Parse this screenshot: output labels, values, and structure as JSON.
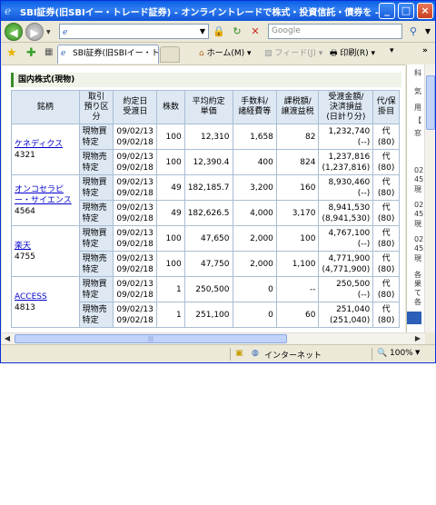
{
  "window": {
    "title": "SBI証券(旧SBIイー・トレード証券) - オンライントレードで株式・投資信託・債券を - Win...",
    "minimize_label": "_",
    "maximize_label": "□",
    "close_label": "×"
  },
  "addressbar": {
    "url": "",
    "search_placeholder": "Google"
  },
  "tabs": [
    {
      "label": "SBI証券(旧SBIイー・トレー..."
    }
  ],
  "commandbar": {
    "home_label": "ホーム(M)",
    "feed_label": "フィード(J)",
    "print_label": "印刷(R)"
  },
  "section": {
    "title": "国内株式(現物)"
  },
  "table": {
    "headers": {
      "meigara": "銘柄",
      "torihiki": "取引\n預り区分",
      "date": "約定日\n受渡日",
      "kabusu": "株数",
      "price": "平均約定\n単価",
      "fee": "手数料/\n諸経費等",
      "tax": "課税額/\n譲渡益税",
      "amount": "受渡金額/\n決済損益\n(日計り分)",
      "dai": "代/保\n掛目"
    },
    "stocks": [
      {
        "name": "ケネディクス",
        "code": "4321",
        "rows": [
          {
            "torihiki": "現物買",
            "kubun": "特定",
            "yakujo": "09/02/13",
            "ukewatashi": "09/02/18",
            "kabusu": "100",
            "price": "12,310",
            "fee": "1,658",
            "tax": "82",
            "amount": "1,232,740",
            "pl": "(--)",
            "dai": "代",
            "kakeme": "(80)"
          },
          {
            "torihiki": "現物売",
            "kubun": "特定",
            "yakujo": "09/02/13",
            "ukewatashi": "09/02/18",
            "kabusu": "100",
            "price": "12,390.4",
            "fee": "400",
            "tax": "824",
            "amount": "1,237,816",
            "pl": "(1,237,816)",
            "dai": "代",
            "kakeme": "(80)"
          }
        ]
      },
      {
        "name": "オンコセラピー・サイエンス",
        "code": "4564",
        "rows": [
          {
            "torihiki": "現物買",
            "kubun": "特定",
            "yakujo": "09/02/13",
            "ukewatashi": "09/02/18",
            "kabusu": "49",
            "price": "182,185.7",
            "fee": "3,200",
            "tax": "160",
            "amount": "8,930,460",
            "pl": "(--)",
            "dai": "代",
            "kakeme": "(80)"
          },
          {
            "torihiki": "現物売",
            "kubun": "特定",
            "yakujo": "09/02/13",
            "ukewatashi": "09/02/18",
            "kabusu": "49",
            "price": "182,626.5",
            "fee": "4,000",
            "tax": "3,170",
            "amount": "8,941,530",
            "pl": "(8,941,530)",
            "dai": "代",
            "kakeme": "(80)"
          }
        ]
      },
      {
        "name": "楽天",
        "code": "4755",
        "rows": [
          {
            "torihiki": "現物買",
            "kubun": "特定",
            "yakujo": "09/02/13",
            "ukewatashi": "09/02/18",
            "kabusu": "100",
            "price": "47,650",
            "fee": "2,000",
            "tax": "100",
            "amount": "4,767,100",
            "pl": "(--)",
            "dai": "代",
            "kakeme": "(80)"
          },
          {
            "torihiki": "現物売",
            "kubun": "特定",
            "yakujo": "09/02/13",
            "ukewatashi": "09/02/18",
            "kabusu": "100",
            "price": "47,750",
            "fee": "2,000",
            "tax": "1,100",
            "amount": "4,771,900",
            "pl": "(4,771,900)",
            "dai": "代",
            "kakeme": "(80)"
          }
        ]
      },
      {
        "name": "ACCESS",
        "code": "4813",
        "rows": [
          {
            "torihiki": "現物買",
            "kubun": "特定",
            "yakujo": "09/02/13",
            "ukewatashi": "09/02/18",
            "kabusu": "1",
            "price": "250,500",
            "fee": "0",
            "tax": "--",
            "amount": "250,500",
            "pl": "(--)",
            "dai": "代",
            "kakeme": "(80)"
          },
          {
            "torihiki": "現物売",
            "kubun": "特定",
            "yakujo": "09/02/13",
            "ukewatashi": "09/02/18",
            "kabusu": "1",
            "price": "251,100",
            "fee": "0",
            "tax": "60",
            "amount": "251,040",
            "pl": "(251,040)",
            "dai": "代",
            "kakeme": "(80)"
          }
        ]
      }
    ]
  },
  "sidebar": {
    "lines": [
      "科",
      "気",
      "用",
      "【",
      "窓",
      "",
      "02",
      "45",
      "現",
      "",
      "02",
      "45",
      "現",
      "",
      "02",
      "45",
      "現",
      "",
      "各",
      "果",
      "て",
      "各"
    ]
  },
  "statusbar": {
    "zone": "インターネット",
    "zoom": "100%"
  }
}
